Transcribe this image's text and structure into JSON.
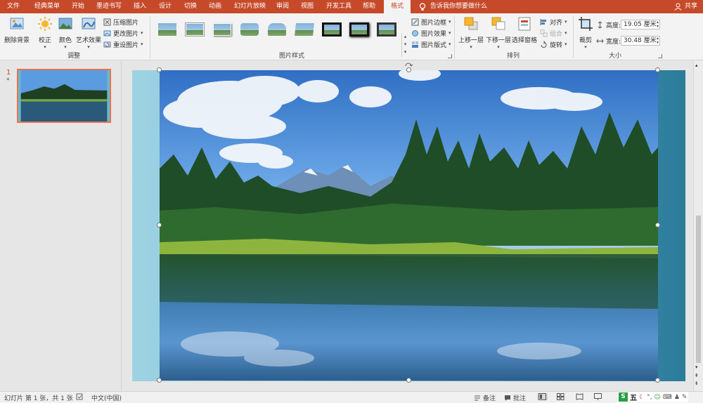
{
  "tabs": [
    {
      "label": "文件",
      "active": false
    },
    {
      "label": "经典菜单",
      "active": false
    },
    {
      "label": "开始",
      "active": false
    },
    {
      "label": "墨迹书写",
      "active": false
    },
    {
      "label": "插入",
      "active": false
    },
    {
      "label": "设计",
      "active": false
    },
    {
      "label": "切换",
      "active": false
    },
    {
      "label": "动画",
      "active": false
    },
    {
      "label": "幻灯片放映",
      "active": false
    },
    {
      "label": "审阅",
      "active": false
    },
    {
      "label": "视图",
      "active": false
    },
    {
      "label": "开发工具",
      "active": false
    },
    {
      "label": "帮助",
      "active": false
    },
    {
      "label": "格式",
      "active": true
    }
  ],
  "tellme": {
    "placeholder": "告诉我你想要做什么"
  },
  "share": {
    "label": "共享"
  },
  "ribbon": {
    "adjust": {
      "remove_bg": "删除背景",
      "corrections": "校正",
      "color": "颜色",
      "artistic": "艺术效果",
      "compress": "压缩图片",
      "change": "更改图片",
      "reset": "重设图片",
      "group_label": "调整"
    },
    "styles": {
      "group_label": "图片样式",
      "border": "图片边框",
      "effects": "图片效果",
      "layout": "图片版式"
    },
    "arrange": {
      "bring_forward": "上移一层",
      "send_backward": "下移一层",
      "selection_pane": "选择窗格",
      "align": "对齐",
      "group": "组合",
      "rotate": "旋转",
      "group_label": "排列"
    },
    "size": {
      "crop": "裁剪",
      "height_label": "高度:",
      "height_value": "19.05 厘米",
      "width_label": "宽度:",
      "width_value": "30.48 厘米",
      "group_label": "大小"
    }
  },
  "thumbnails": {
    "number": "1",
    "star": "*"
  },
  "status": {
    "slide_info": "幻灯片 第 1 张，共 1 张",
    "language": "中文(中国)",
    "notes": "备注",
    "comments": "批注"
  },
  "colors": {
    "accent": "#c64a2a",
    "selection": "#e8734d"
  }
}
